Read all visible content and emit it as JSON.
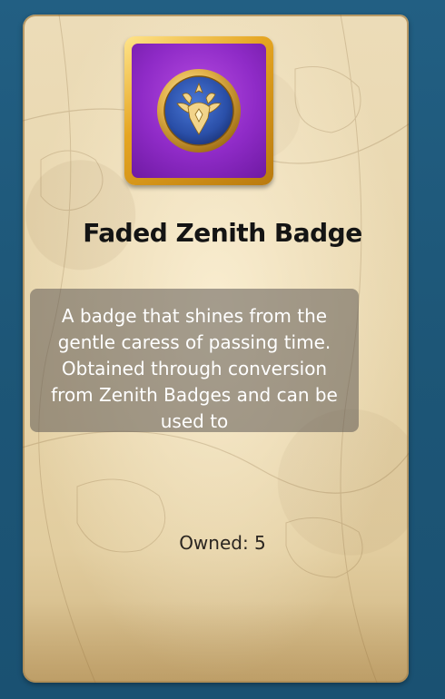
{
  "item": {
    "icon": "faded-zenith-badge-icon",
    "name": "Faded Zenith Badge",
    "description": "A badge that shines from the gentle caress of passing time. Obtained through conversion from Zenith Badges and can be used to",
    "owned_label": "Owned: 5"
  },
  "colors": {
    "background": "#1f5a7d",
    "parchment": "#e8d6ad",
    "frame_gold": "#e5a521",
    "badge_purple": "#8f2bc7",
    "medallion_blue": "#2a4fa8"
  }
}
